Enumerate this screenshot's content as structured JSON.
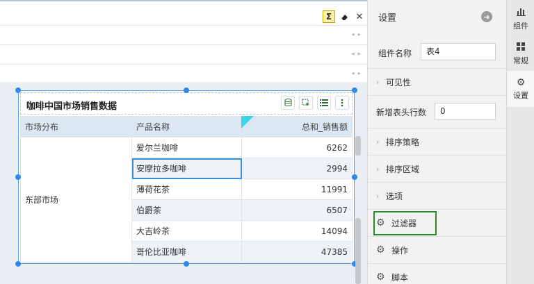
{
  "toolbar": {
    "sigma_icon": "Σ",
    "eraser_icon": "eraser-icon",
    "close_icon": "✕"
  },
  "formula_rows": [
    {
      "arrows": "◂ ▸"
    },
    {
      "arrows": "◂ ▸"
    },
    {
      "arrows": "◂ ▸"
    }
  ],
  "component": {
    "title": "咖啡中国市场销售数据",
    "headers": [
      "市场分布",
      "产品名称",
      "总和_销售额"
    ],
    "region": "东部市场",
    "rows": [
      {
        "product": "爱尔兰咖啡",
        "sales": "6262"
      },
      {
        "product": "安摩拉多咖啡",
        "sales": "2994"
      },
      {
        "product": "薄荷花茶",
        "sales": "11991"
      },
      {
        "product": "伯爵茶",
        "sales": "6507"
      },
      {
        "product": "大吉岭茶",
        "sales": "14094"
      },
      {
        "product": "哥伦比亚咖啡",
        "sales": "47385"
      }
    ],
    "selected_row_index": 1
  },
  "panel": {
    "title": "设置",
    "component_name_label": "组件名称",
    "component_name_value": "表4",
    "sections_top": [
      {
        "label": "可见性"
      }
    ],
    "header_rows_label": "新增表头行数",
    "header_rows_value": "0",
    "sections": [
      {
        "label": "排序策略"
      },
      {
        "label": "排序区域"
      },
      {
        "label": "选项"
      }
    ],
    "gear_items": [
      {
        "label": "过滤器",
        "highlighted": true
      },
      {
        "label": "操作",
        "highlighted": false
      },
      {
        "label": "脚本",
        "highlighted": false
      }
    ]
  },
  "side_tabs": [
    {
      "label": "组件",
      "icon": "bar-chart-icon",
      "active": false
    },
    {
      "label": "常规",
      "icon": "grid-icon",
      "active": false
    },
    {
      "label": "设置",
      "icon": "gear-icon",
      "active": true
    }
  ],
  "colors": {
    "accent_blue": "#2f89e8",
    "highlight_green": "#2b8a2b",
    "header_fill": "#dbe7f2"
  }
}
